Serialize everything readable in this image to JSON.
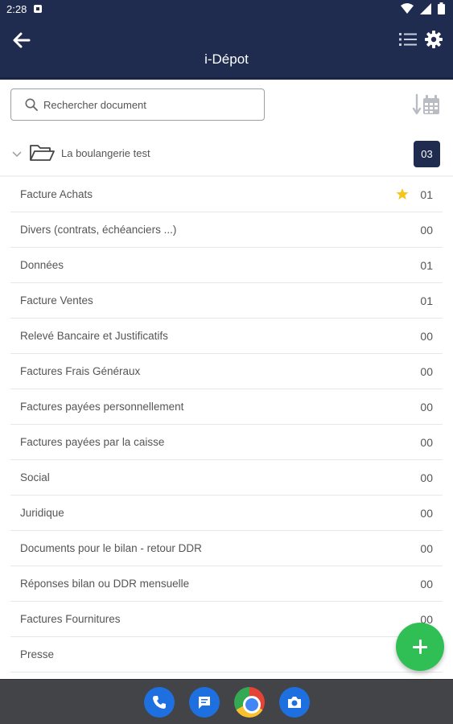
{
  "status_bar": {
    "time": "2:28",
    "icons": [
      "notification-icon",
      "wifi-icon",
      "signal-icon",
      "battery-icon"
    ]
  },
  "header": {
    "title": "i-Dépot",
    "icons": [
      "back-arrow-icon",
      "list-view-icon",
      "gear-icon"
    ]
  },
  "search": {
    "placeholder": "Rechercher document",
    "value": ""
  },
  "folder": {
    "name": "La boulangerie test",
    "count": "03"
  },
  "documents": [
    {
      "label": "Facture Achats",
      "count": "01",
      "starred": true
    },
    {
      "label": "Divers (contrats, échéanciers ...)",
      "count": "00",
      "starred": false
    },
    {
      "label": "Données",
      "count": "01",
      "starred": false
    },
    {
      "label": "Facture Ventes",
      "count": "01",
      "starred": false
    },
    {
      "label": "Relevé Bancaire et Justificatifs",
      "count": "00",
      "starred": false
    },
    {
      "label": "Factures Frais Généraux",
      "count": "00",
      "starred": false
    },
    {
      "label": "Factures payées personnellement",
      "count": "00",
      "starred": false
    },
    {
      "label": "Factures payées par la caisse",
      "count": "00",
      "starred": false
    },
    {
      "label": "Social",
      "count": "00",
      "starred": false
    },
    {
      "label": "Juridique",
      "count": "00",
      "starred": false
    },
    {
      "label": "Documents pour le bilan - retour DDR",
      "count": "00",
      "starred": false
    },
    {
      "label": "Réponses bilan ou DDR mensuelle",
      "count": "00",
      "starred": false
    },
    {
      "label": "Factures Fournitures",
      "count": "00",
      "starred": false
    },
    {
      "label": "Presse",
      "count": "",
      "starred": false
    }
  ],
  "colors": {
    "header_bg": "#1f2c50",
    "fab": "#2fbf55",
    "star": "#f5c518",
    "dock_bg": "#424448"
  },
  "dock_apps": [
    "phone-icon",
    "messages-icon",
    "chrome-icon",
    "camera-icon"
  ]
}
